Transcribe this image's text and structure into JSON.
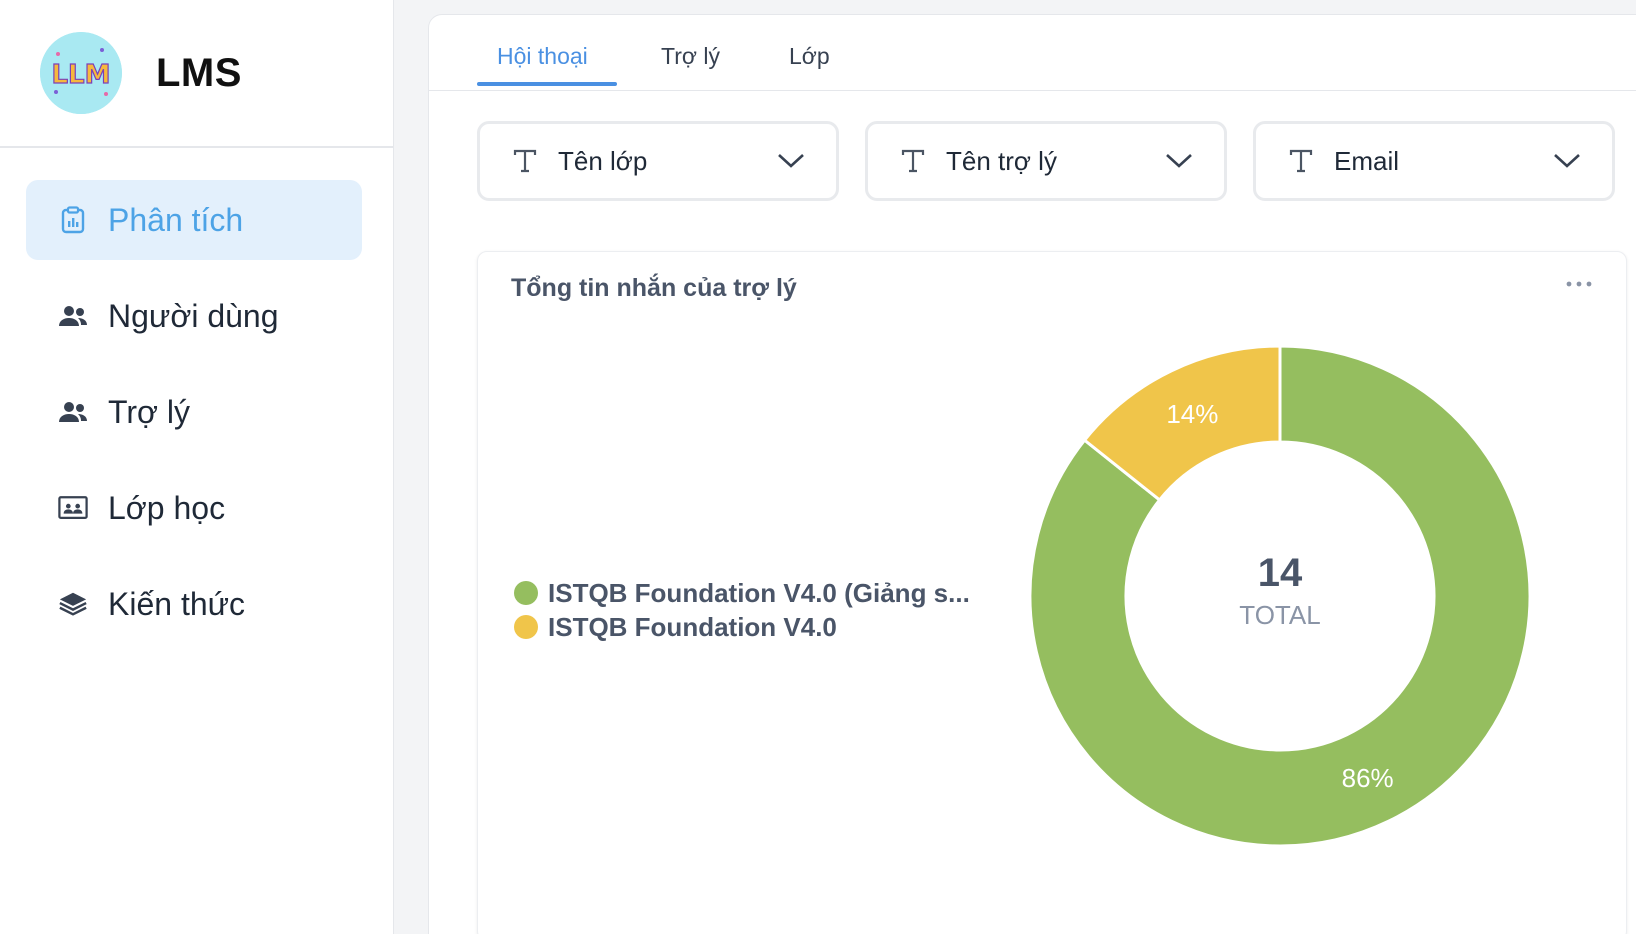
{
  "app": {
    "title": "LMS",
    "logo_text": "LLM"
  },
  "sidebar": {
    "items": [
      {
        "label": "Phân tích",
        "icon": "clipboard-chart-icon",
        "active": true
      },
      {
        "label": "Người dùng",
        "icon": "users-icon",
        "active": false
      },
      {
        "label": "Trợ lý",
        "icon": "users-icon",
        "active": false
      },
      {
        "label": "Lớp học",
        "icon": "classroom-board-icon",
        "active": false
      },
      {
        "label": "Kiến thức",
        "icon": "layers-icon",
        "active": false
      }
    ]
  },
  "tabs": [
    {
      "label": "Hội thoại",
      "active": true
    },
    {
      "label": "Trợ lý",
      "active": false
    },
    {
      "label": "Lớp",
      "active": false
    }
  ],
  "filters": [
    {
      "label": "Tên lớp",
      "icon": "text-type-icon"
    },
    {
      "label": "Tên trợ lý",
      "icon": "text-type-icon"
    },
    {
      "label": "Email",
      "icon": "text-type-icon"
    }
  ],
  "chart": {
    "title": "Tổng tin nhắn của trợ lý",
    "center_value": "14",
    "center_label": "TOTAL"
  },
  "chart_data": {
    "type": "pie",
    "title": "Tổng tin nhắn của trợ lý",
    "categories": [
      "ISTQB Foundation V4.0 (Giảng s...",
      "ISTQB Foundation V4.0"
    ],
    "values": [
      12,
      2
    ],
    "percent_labels": [
      "86%",
      "14%"
    ],
    "colors": [
      "#95be5f",
      "#f0c54a"
    ],
    "total": 14,
    "legend_position": "left"
  },
  "colors": {
    "accent": "#4a90e2",
    "active_nav_bg": "#e3f0fc",
    "active_nav_text": "#4da3e6"
  }
}
